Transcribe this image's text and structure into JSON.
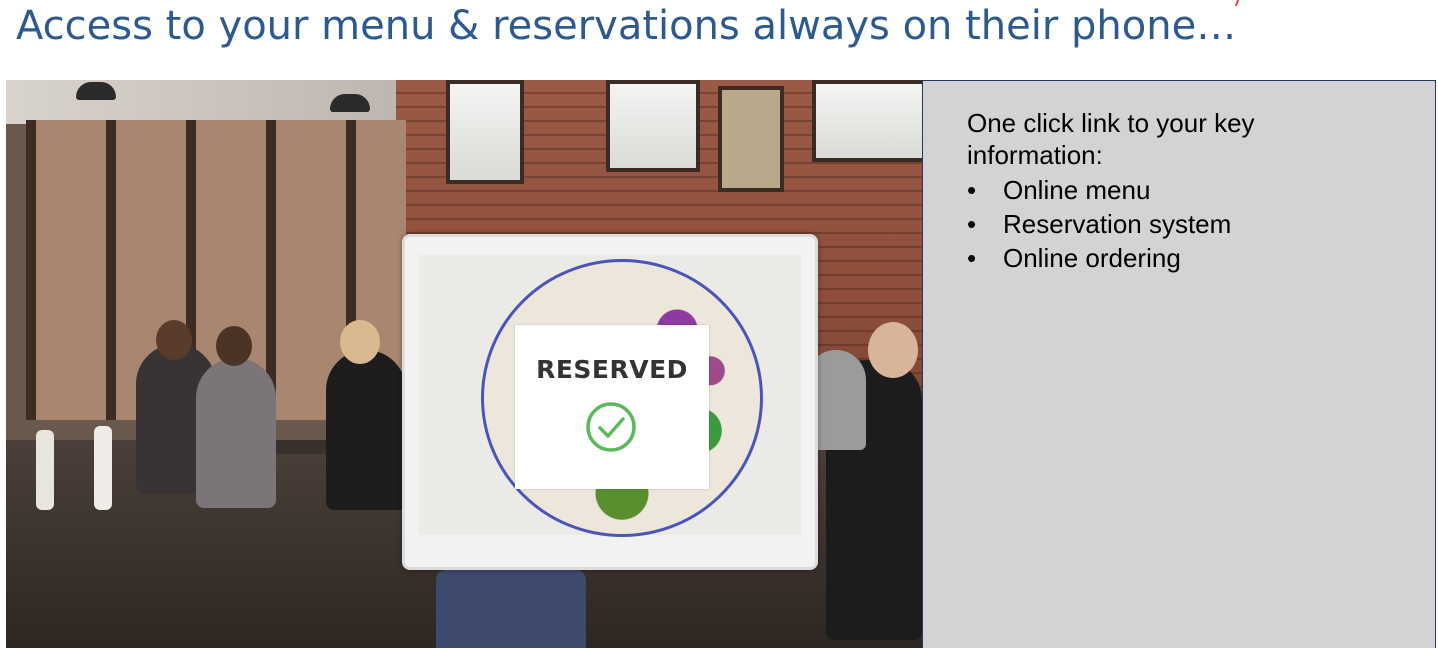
{
  "slide": {
    "title": "Access to your menu & reservations always on their phone…"
  },
  "photo": {
    "card_text": "RESERVED",
    "icon": "check-circle-icon",
    "check_color": "#5bb95b"
  },
  "panel": {
    "intro": "One click link to your key information:",
    "bullet_glyph": "•",
    "items": [
      {
        "label": "Online menu"
      },
      {
        "label": "Reservation system"
      },
      {
        "label": "Online ordering"
      }
    ]
  },
  "colors": {
    "title": "#2d5a8e",
    "panel_bg": "#d3d3d3",
    "panel_border": "#1f3a64"
  }
}
